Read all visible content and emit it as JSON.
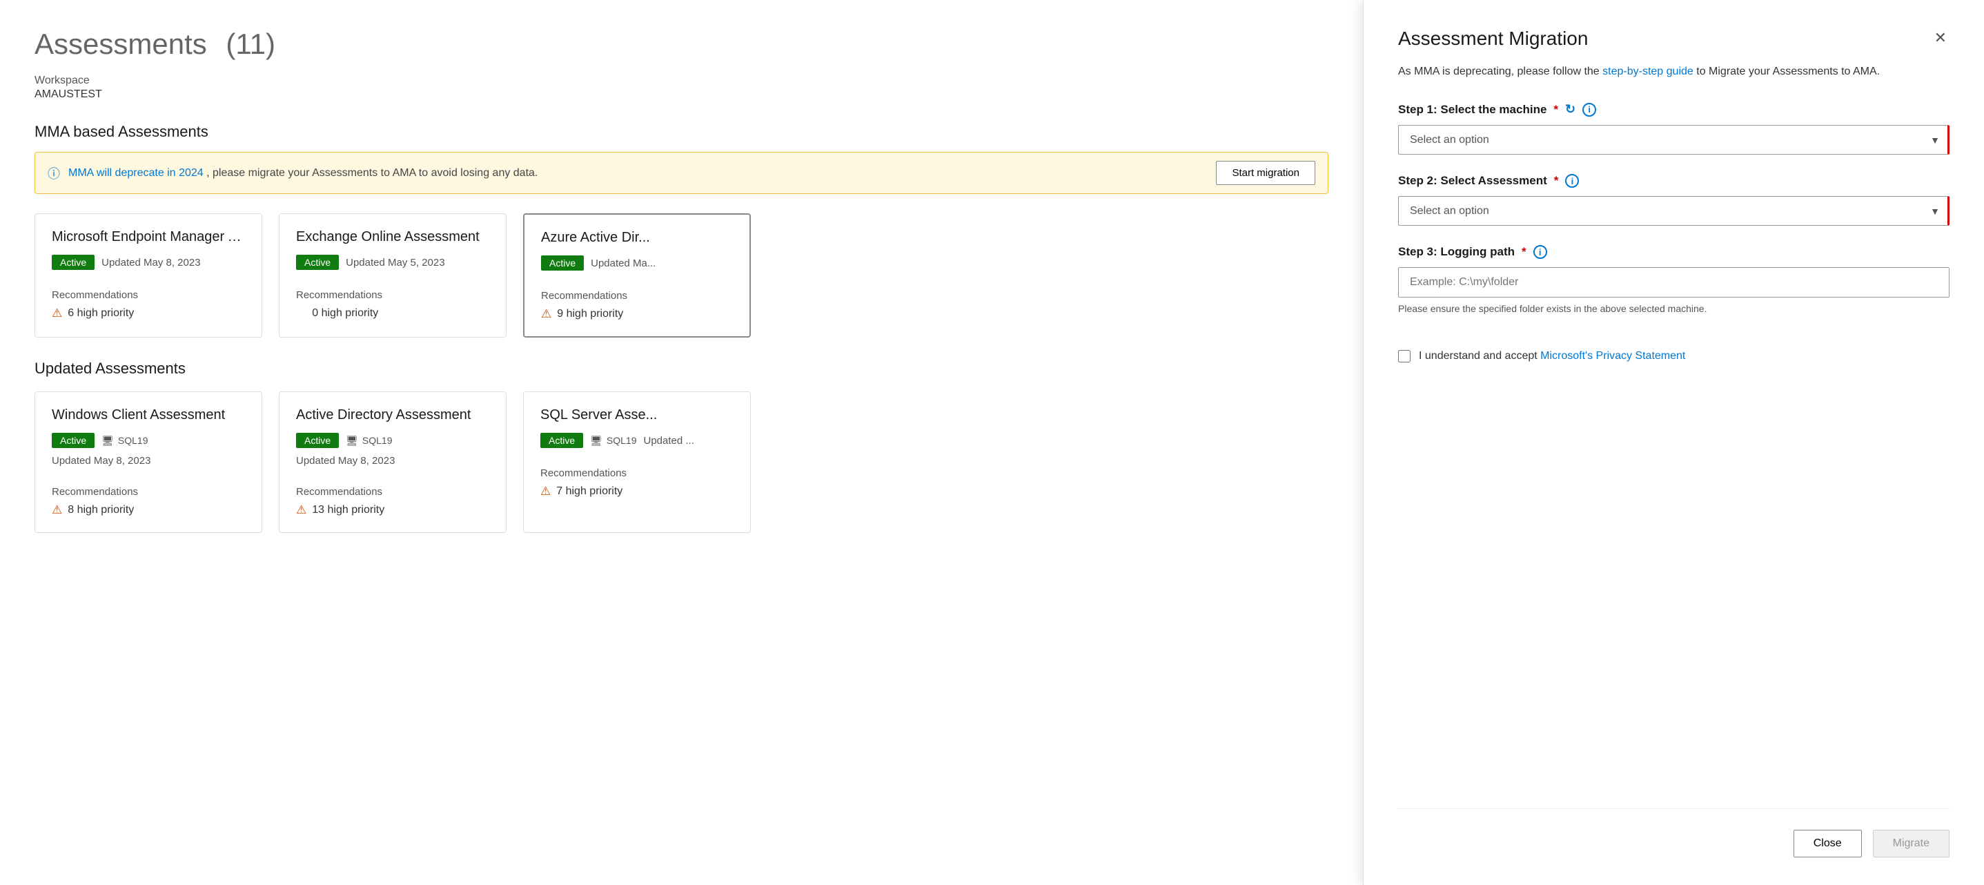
{
  "page": {
    "title": "Assessments",
    "count": "(11)",
    "workspace_label": "Workspace",
    "workspace_name": "AMAUSTEST"
  },
  "mma_section": {
    "title": "MMA based Assessments",
    "banner_text": "MMA will deprecate in 2024, please migrate your Assessments to AMA to avoid losing any data.",
    "banner_link": "MMA will deprecate in 2024",
    "start_btn": "Start migration"
  },
  "mma_cards": [
    {
      "title": "Microsoft Endpoint Manager A...",
      "status": "Active",
      "updated": "Updated May 8, 2023",
      "recommendations_label": "Recommendations",
      "priority_count": "6 high priority"
    },
    {
      "title": "Exchange Online Assessment",
      "status": "Active",
      "updated": "Updated May 5, 2023",
      "recommendations_label": "Recommendations",
      "priority_count": "0 high priority"
    },
    {
      "title": "Azure Active Dir...",
      "status": "Active",
      "updated": "Updated Ma...",
      "recommendations_label": "Recommendations",
      "priority_count": "9 high priority"
    }
  ],
  "updated_section": {
    "title": "Updated Assessments"
  },
  "updated_cards": [
    {
      "title": "Windows Client Assessment",
      "status": "Active",
      "machine": "SQL19",
      "updated": "Updated May 8, 2023",
      "recommendations_label": "Recommendations",
      "priority_count": "8 high priority"
    },
    {
      "title": "Active Directory Assessment",
      "status": "Active",
      "machine": "SQL19",
      "updated": "Updated May 8, 2023",
      "recommendations_label": "Recommendations",
      "priority_count": "13 high priority"
    },
    {
      "title": "SQL Server Asse...",
      "status": "Active",
      "machine": "SQL19",
      "updated": "Updated ...",
      "recommendations_label": "Recommendations",
      "priority_count": "7 high priority"
    }
  ],
  "drawer": {
    "title": "Assessment Migration",
    "description_start": "As MMA is deprecating, please follow the ",
    "description_link": "step-by-step guide",
    "description_end": " to Migrate your Assessments to AMA.",
    "step1_label": "Step 1: Select the machine",
    "step1_placeholder": "Select an option",
    "step2_label": "Step 2: Select Assessment",
    "step2_placeholder": "Select an option",
    "step3_label": "Step 3: Logging path",
    "step3_placeholder": "Example: C:\\my\\folder",
    "step3_hint": "Please ensure the specified folder exists in the above selected machine.",
    "checkbox_text_start": "I understand and accept ",
    "checkbox_link": "Microsoft's Privacy Statement",
    "close_btn": "Close",
    "migrate_btn": "Migrate"
  }
}
